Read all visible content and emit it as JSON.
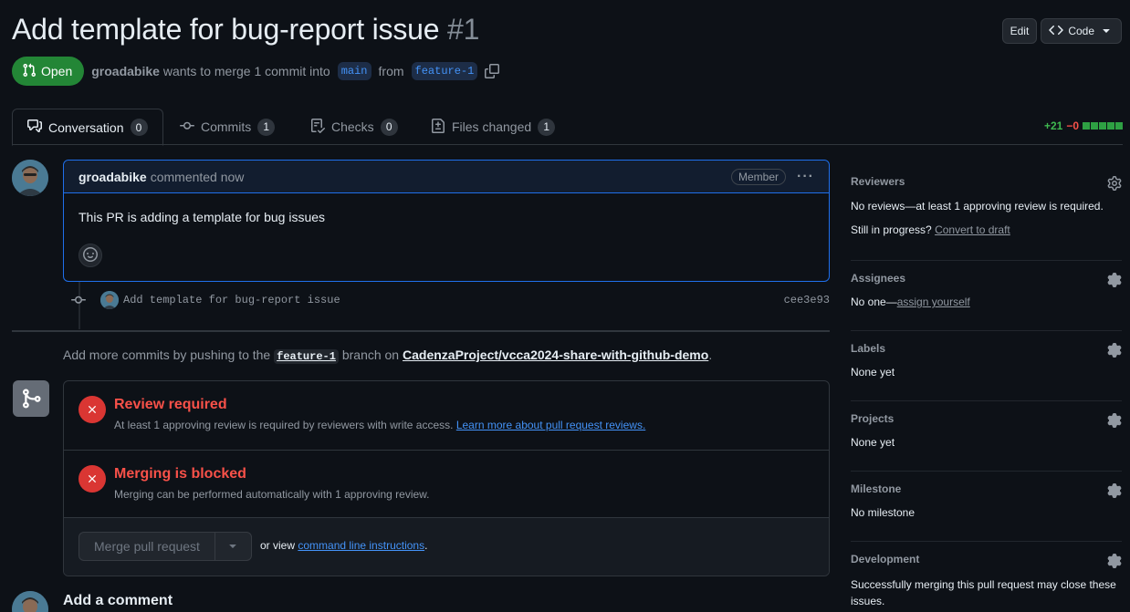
{
  "header": {
    "title": "Add template for bug-report issue",
    "number": "#1",
    "edit_label": "Edit",
    "code_label": "Code"
  },
  "meta": {
    "status": "Open",
    "author": "groadabike",
    "text_merge": "wants to merge 1 commit into",
    "base_branch": "main",
    "text_from": "from",
    "head_branch": "feature-1"
  },
  "tabs": [
    {
      "label": "Conversation",
      "count": "0"
    },
    {
      "label": "Commits",
      "count": "1"
    },
    {
      "label": "Checks",
      "count": "0"
    },
    {
      "label": "Files changed",
      "count": "1"
    }
  ],
  "diffstat": {
    "additions": "+21",
    "deletions": "−0"
  },
  "comment": {
    "author": "groadabike",
    "action": "commented now",
    "role": "Member",
    "body": "This PR is adding a template for bug issues"
  },
  "commit": {
    "message": "Add template for bug-report issue",
    "sha": "cee3e93"
  },
  "push_hint": {
    "prefix": "Add more commits by pushing to the",
    "branch": "feature-1",
    "middle": "branch on",
    "repo": "CadenzaProject/vcca2024-share-with-github-demo",
    "suffix": "."
  },
  "mergebox": {
    "review_title": "Review required",
    "review_sub": "At least 1 approving review is required by reviewers with write access.",
    "review_link": "Learn more about pull request reviews.",
    "blocked_title": "Merging is blocked",
    "blocked_sub": "Merging can be performed automatically with 1 approving review.",
    "merge_button": "Merge pull request",
    "or_view": "or view",
    "cli_link": "command line instructions",
    "cli_suffix": "."
  },
  "add_comment": "Add a comment",
  "sidebar": {
    "reviewers": {
      "heading": "Reviewers",
      "text": "No reviews—at least 1 approving review is required.",
      "progress": "Still in progress?",
      "draft_link": "Convert to draft"
    },
    "assignees": {
      "heading": "Assignees",
      "prefix": "No one—",
      "link": "assign yourself"
    },
    "labels": {
      "heading": "Labels",
      "text": "None yet"
    },
    "projects": {
      "heading": "Projects",
      "text": "None yet"
    },
    "milestone": {
      "heading": "Milestone",
      "text": "No milestone"
    },
    "development": {
      "heading": "Development",
      "text": "Successfully merging this pull request may close these issues."
    }
  },
  "colors": {
    "background": "#0d1117",
    "open_badge": "#238636",
    "error": "#f85149",
    "link": "#4493f8",
    "accent_border": "#1f6feb"
  },
  "icons": [
    "git-pull-request-icon",
    "code-icon",
    "copy-icon",
    "comment-discussion-icon",
    "git-commit-icon",
    "checklist-icon",
    "file-diff-icon",
    "kebab-horizontal-icon",
    "smiley-icon",
    "git-merge-icon",
    "x-icon",
    "triangle-down-icon",
    "gear-icon"
  ]
}
